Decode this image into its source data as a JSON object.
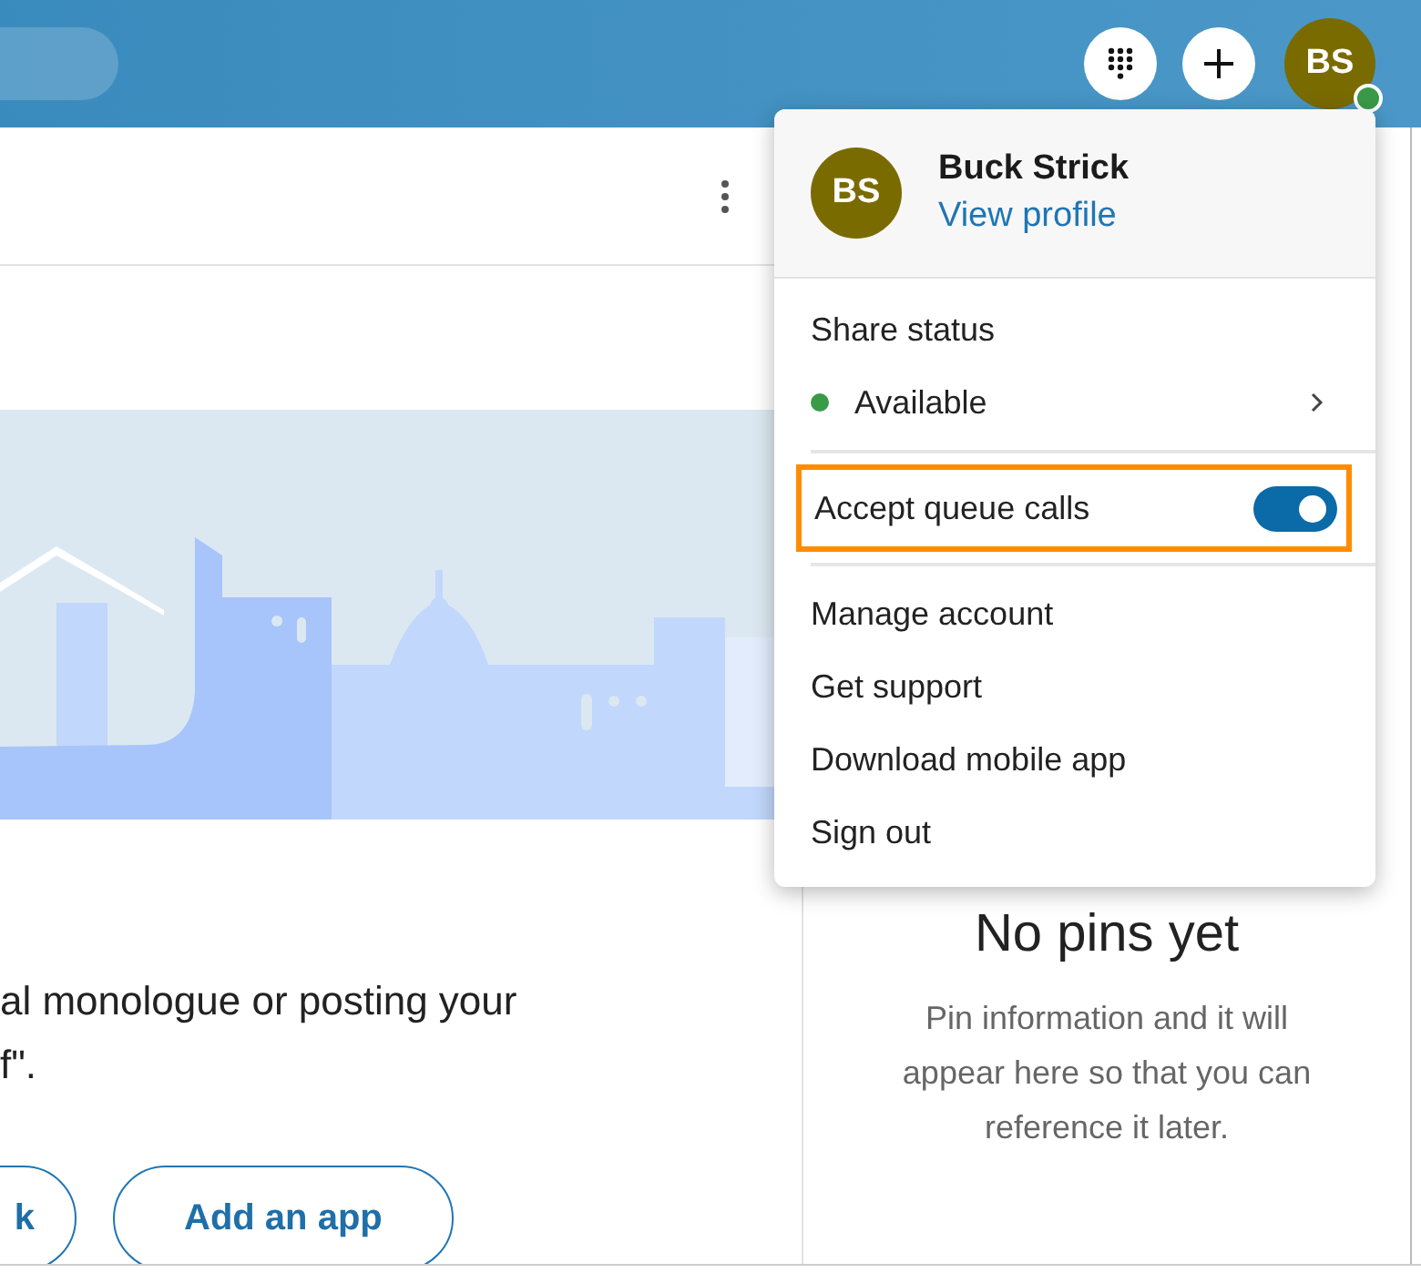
{
  "header": {
    "avatar": {
      "initials": "BS",
      "color": "#3a9a48"
    }
  },
  "main": {
    "message_lines": [
      "al monologue or posting your",
      "f\"."
    ],
    "buttons": [
      "k",
      "Add an app"
    ]
  },
  "pins": {
    "title": "No pins yet",
    "description": "Pin information and it will appear here so that you can reference it later."
  },
  "user_menu": {
    "initials": "BS",
    "name": "Buck Strick",
    "profile_link": "View profile",
    "items": [
      {
        "kind": "label",
        "label": "Share status"
      },
      {
        "kind": "status",
        "label": "Available",
        "color": "#3a9a48"
      },
      {
        "kind": "divider"
      },
      {
        "kind": "toggle",
        "label": "Accept queue calls",
        "on": true,
        "highlighted": true
      },
      {
        "kind": "divider"
      },
      {
        "kind": "link",
        "label": "Manage account"
      },
      {
        "kind": "link",
        "label": "Get support"
      },
      {
        "kind": "link",
        "label": "Download mobile app"
      },
      {
        "kind": "link",
        "label": "Sign out"
      }
    ]
  }
}
